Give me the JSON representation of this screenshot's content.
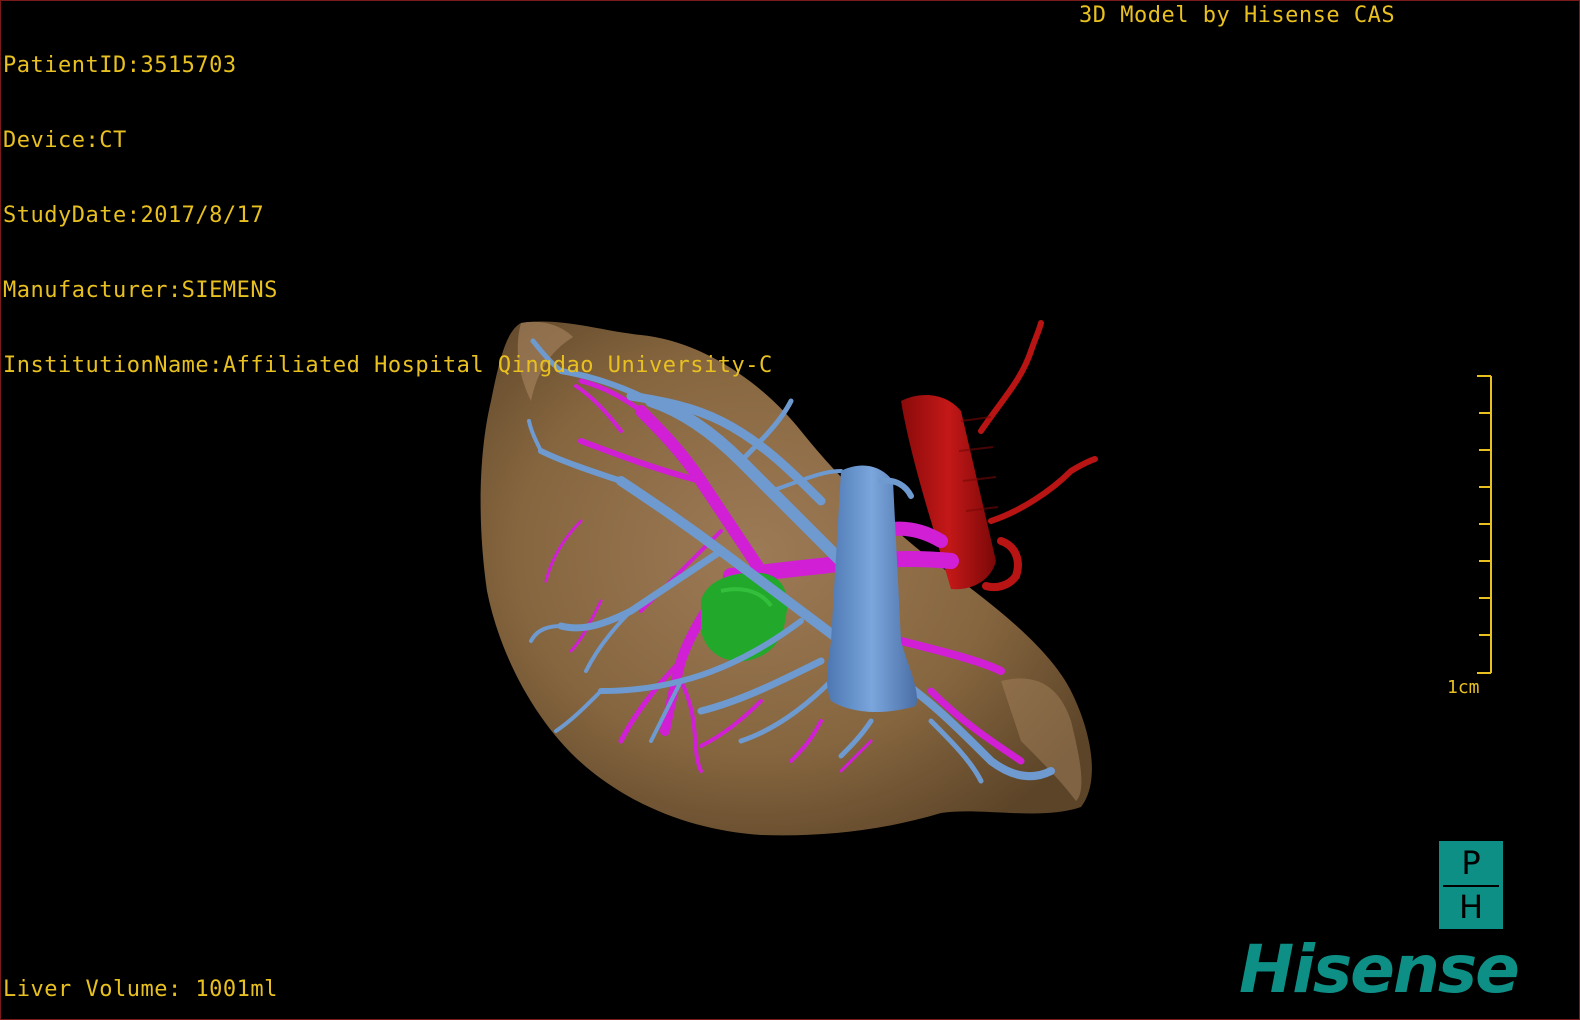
{
  "viewer": {
    "patient_info": [
      "PatientID:3515703",
      "Device:CT",
      "StudyDate:2017/8/17",
      "Manufacturer:SIEMENS",
      "InstitutionName:Affiliated Hospital Qingdao University-C"
    ],
    "watermark": "3D Model by Hisense CAS",
    "liver_volume": "Liver Volume: 1001ml",
    "scale_label": "1cm"
  },
  "branding": {
    "ph_top": "P",
    "ph_bottom": "H",
    "company": "Hisense"
  },
  "colors": {
    "overlay_text": "#e8c020",
    "liver": "#8a6a48",
    "hepatic_vein": "#6e9ad0",
    "portal_vein": "#d11fd6",
    "artery": "#b81414",
    "tumor": "#22a82a",
    "brand_teal": "#0d8f86",
    "border": "#7a1a1a"
  },
  "icons": {
    "scale": "scale-bar-icon",
    "ph_logo": "ph-logo-icon",
    "hisense_logo": "hisense-logo-icon"
  }
}
